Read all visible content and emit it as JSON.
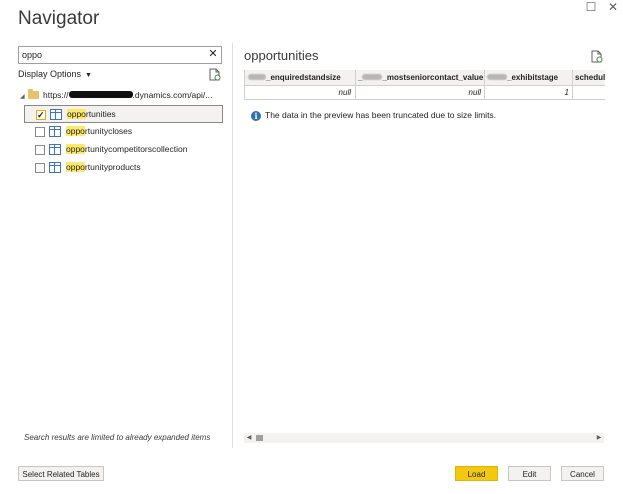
{
  "window": {
    "title": "Navigator",
    "maximize_glyph": "☐",
    "close_glyph": "✕"
  },
  "left": {
    "search": {
      "value": "oppo",
      "placeholder": ""
    },
    "clear_glyph": "✕",
    "display_options": "Display Options",
    "tree_root": {
      "prefix": "https://",
      "suffix": ".dynamics.com/api/..."
    },
    "items": [
      {
        "highlight": "oppo",
        "rest": "rtunities",
        "checked": true
      },
      {
        "highlight": "oppo",
        "rest": "rtunitycloses",
        "checked": false
      },
      {
        "highlight": "oppo",
        "rest": "rtunitycompetitorscollection",
        "checked": false
      },
      {
        "highlight": "oppo",
        "rest": "rtunityproducts",
        "checked": false
      }
    ],
    "search_note": "Search results are limited to already expanded items"
  },
  "preview": {
    "title": "opportunities",
    "columns": [
      "_enquiredstandsize",
      "_mostseniorcontact_value",
      "_exhibitstage",
      "schedul"
    ],
    "row": [
      "null",
      "null",
      "1",
      ""
    ],
    "info_text": "The data in the preview has been truncated due to size limits."
  },
  "buttons": {
    "select_related": "Select Related Tables",
    "load": "Load",
    "edit": "Edit",
    "cancel": "Cancel"
  },
  "colors": {
    "accent": "#f2c811",
    "highlight": "#fde96a",
    "table_icon": "#3f74c0",
    "info_icon": "#2f6fb6"
  }
}
